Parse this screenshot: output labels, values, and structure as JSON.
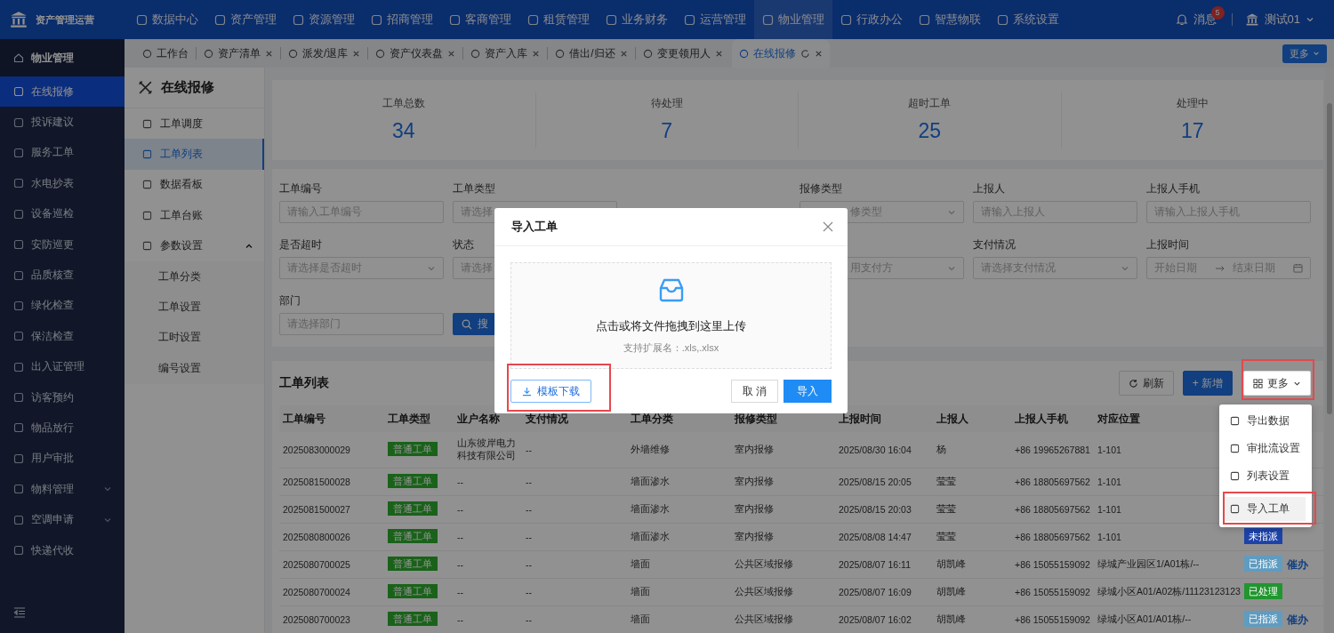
{
  "app": {
    "title": "资产管理运营"
  },
  "top_nav": [
    {
      "label": "数据中心",
      "selected": false
    },
    {
      "label": "资产管理",
      "selected": false
    },
    {
      "label": "资源管理",
      "selected": false
    },
    {
      "label": "招商管理",
      "selected": false
    },
    {
      "label": "客商管理",
      "selected": false
    },
    {
      "label": "租赁管理",
      "selected": false
    },
    {
      "label": "业务财务",
      "selected": false
    },
    {
      "label": "运营管理",
      "selected": false
    },
    {
      "label": "物业管理",
      "selected": true
    },
    {
      "label": "行政办公",
      "selected": false
    },
    {
      "label": "智慧物联",
      "selected": false
    },
    {
      "label": "系统设置",
      "selected": false
    }
  ],
  "header_right": {
    "messages": "消息",
    "badge": "5",
    "user": "测试01"
  },
  "sidebar": {
    "title": "物业管理",
    "items": [
      {
        "label": "在线报修",
        "selected": true
      },
      {
        "label": "投诉建议",
        "selected": false
      },
      {
        "label": "服务工单",
        "selected": false
      },
      {
        "label": "水电抄表",
        "selected": false
      },
      {
        "label": "设备巡检",
        "selected": false
      },
      {
        "label": "安防巡更",
        "selected": false
      },
      {
        "label": "品质核查",
        "selected": false
      },
      {
        "label": "绿化检查",
        "selected": false
      },
      {
        "label": "保洁检查",
        "selected": false
      },
      {
        "label": "出入证管理",
        "selected": false
      },
      {
        "label": "访客预约",
        "selected": false
      },
      {
        "label": "物品放行",
        "selected": false
      },
      {
        "label": "用户审批",
        "selected": false
      },
      {
        "label": "物料管理",
        "selected": false,
        "expandable": true
      },
      {
        "label": "空调申请",
        "selected": false,
        "expandable": true
      },
      {
        "label": "快递代收",
        "selected": false
      }
    ]
  },
  "tabs": [
    {
      "label": "工作台",
      "selected": false,
      "closable": false
    },
    {
      "label": "资产清单",
      "selected": false,
      "closable": true
    },
    {
      "label": "派发/退库",
      "selected": false,
      "closable": true
    },
    {
      "label": "资产仪表盘",
      "selected": false,
      "closable": true
    },
    {
      "label": "资产入库",
      "selected": false,
      "closable": true
    },
    {
      "label": "借出/归还",
      "selected": false,
      "closable": true
    },
    {
      "label": "变更领用人",
      "selected": false,
      "closable": true
    },
    {
      "label": "在线报修",
      "selected": true,
      "closable": true
    }
  ],
  "tabs_more": "更多",
  "sub_nav": {
    "title": "在线报修",
    "items": [
      {
        "label": "工单调度",
        "selected": false
      },
      {
        "label": "工单列表",
        "selected": true
      },
      {
        "label": "数据看板",
        "selected": false
      },
      {
        "label": "工单台账",
        "selected": false
      },
      {
        "label": "参数设置",
        "selected": false,
        "expanded": true,
        "children": [
          {
            "label": "工单分类"
          },
          {
            "label": "工单设置"
          },
          {
            "label": "工时设置"
          },
          {
            "label": "编号设置"
          }
        ]
      }
    ]
  },
  "stats": [
    {
      "label": "工单总数",
      "value": "34"
    },
    {
      "label": "待处理",
      "value": "7"
    },
    {
      "label": "超时工单",
      "value": "25"
    },
    {
      "label": "处理中",
      "value": "17"
    }
  ],
  "filters": [
    {
      "left_fields": [
        {
          "label": "工单编号",
          "kind": "input",
          "placeholder": "请输入工单编号"
        },
        {
          "label": "工单类型",
          "kind": "input",
          "placeholder": "请选择"
        }
      ],
      "right_fields": [
        {
          "label": "报修类型",
          "kind": "select",
          "placeholder": "修类型",
          "partly_hidden": true
        },
        {
          "label": "上报人",
          "kind": "input",
          "placeholder": "请输入上报人"
        },
        {
          "label": "上报人手机",
          "kind": "input",
          "placeholder": "请输入上报人手机"
        }
      ]
    },
    {
      "left_fields": [
        {
          "label": "是否超时",
          "kind": "select",
          "placeholder": "请选择是否超时"
        },
        {
          "label": "状态",
          "kind": "input",
          "placeholder": "请选择"
        }
      ],
      "right_fields": [
        {
          "kind": "select",
          "placeholder": "用支付方",
          "partly_hidden": true
        },
        {
          "label": "支付情况",
          "kind": "select",
          "placeholder": "请选择支付情况"
        },
        {
          "label": "上报时间",
          "kind": "date_range",
          "placeholder": "开始日期",
          "placeholder_end": "结束日期"
        }
      ]
    },
    {
      "left_fields": [
        {
          "label": "部门",
          "kind": "input",
          "placeholder": "请选择部门"
        },
        {
          "kind": "button",
          "text": "搜"
        }
      ]
    }
  ],
  "table": {
    "title": "工单列表",
    "buttons": [
      {
        "label": "刷新",
        "kind": "refresh"
      },
      {
        "label": "+ 新增",
        "kind": "primary"
      }
    ],
    "more": {
      "label": "更多",
      "highlighted": true
    },
    "more_menu": [
      {
        "label": "导出数据",
        "highlighted": false
      },
      {
        "label": "审批流设置",
        "highlighted": false
      },
      {
        "label": "列表设置",
        "highlighted": false
      },
      {
        "label": "导入工单",
        "highlighted": true
      }
    ],
    "columns": [
      "工单编号",
      "工单类型",
      "业户名称",
      "支付情况",
      "工单分类",
      "报修类型",
      "上报时间",
      "上报人",
      "上报人手机",
      "对应位置"
    ],
    "rows": [
      {
        "cells": [
          "2025083000029",
          "普通工单",
          "山东彼岸电力科技有限公司",
          "--",
          "外墙维修",
          "室内报修",
          "2025/08/30 16:04",
          "杨",
          "+86 19965267881",
          "1-101"
        ]
      },
      {
        "cells": [
          "2025081500028",
          "普通工单",
          "--",
          "--",
          "墙面渗水",
          "室内报修",
          "2025/08/15 20:05",
          "莹莹",
          "+86 18805697562",
          "1-101"
        ]
      },
      {
        "cells": [
          "2025081500027",
          "普通工单",
          "--",
          "--",
          "墙面渗水",
          "室内报修",
          "2025/08/15 20:03",
          "莹莹",
          "+86 18805697562",
          "1-101"
        ]
      },
      {
        "cells": [
          "2025080800026",
          "普通工单",
          "--",
          "--",
          "墙面渗水",
          "室内报修",
          "2025/08/08 14:47",
          "莹莹",
          "+86 18805697562",
          "1-101"
        ],
        "status": {
          "text": "未指派",
          "color": "#1d42a8"
        }
      },
      {
        "cells": [
          "2025080700025",
          "普通工单",
          "--",
          "--",
          "墙面",
          "公共区域报修",
          "2025/08/07 16:11",
          "胡凯峰",
          "+86 15055159092",
          "绿城产业园区1/A01栋/--"
        ],
        "status": {
          "text": "已指派",
          "color": "#5f9cc0"
        },
        "action": "催办"
      },
      {
        "cells": [
          "2025080700024",
          "普通工单",
          "--",
          "--",
          "墙面",
          "公共区域报修",
          "2025/08/07 16:09",
          "胡凯峰",
          "+86 15055159092",
          "绿城小区A01/A02栋/11123123123"
        ],
        "status": {
          "text": "已处理",
          "color": "#21962f"
        }
      },
      {
        "cells": [
          "2025080700023",
          "普通工单",
          "--",
          "--",
          "墙面",
          "公共区域报修",
          "2025/08/07 16:02",
          "胡凯峰",
          "+86 15055159092",
          "绿城小区A01/A01栋/--"
        ],
        "status": {
          "text": "已指派",
          "color": "#5f9cc0"
        },
        "action": "催办"
      }
    ]
  },
  "dialog": {
    "title": "导入工单",
    "upload_text": "点击或将文件拖拽到这里上传",
    "upload_hint": "支持扩展名：.xls,.xlsx",
    "template_button": {
      "label": "模板下载",
      "highlighted": true
    },
    "cancel": "取 消",
    "confirm": "导入"
  }
}
